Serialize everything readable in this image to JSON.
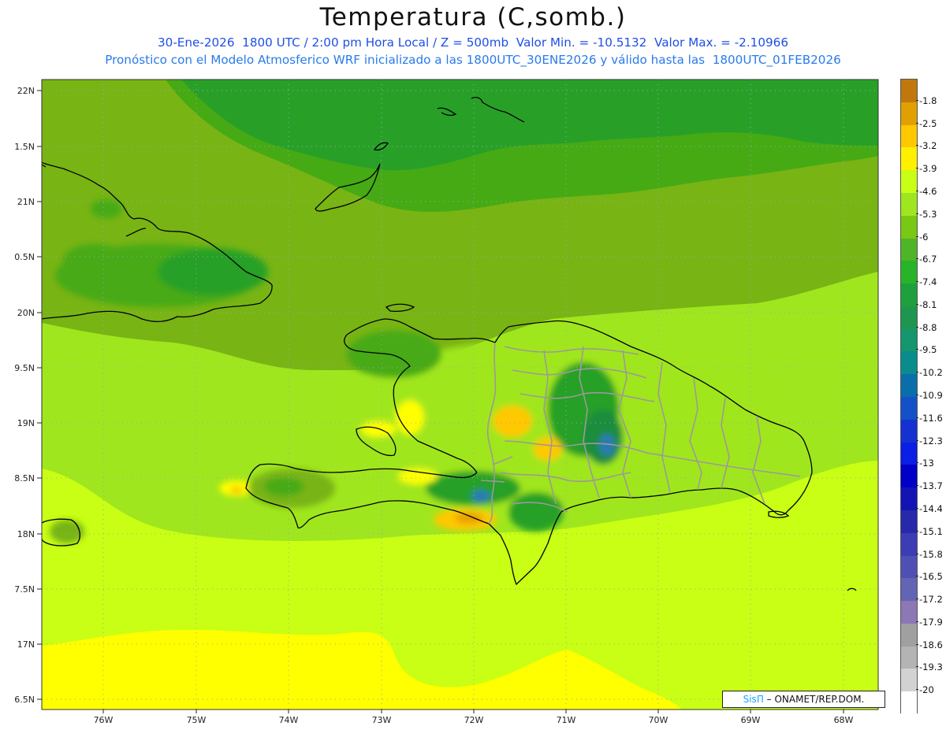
{
  "title": "Temperatura (C,somb.)",
  "subtitle_line1": "30-Ene-2026  1800 UTC / 2:00 pm Hora Local / Z = 500mb  Valor Min. = -10.5132  Valor Max. = -2.10966",
  "subtitle_line2": "Pronóstico con el Modelo Atmosferico WRF inicializado a las 1800UTC_30ENE2026 y válido hasta las  1800UTC_01FEB2026",
  "credit": {
    "brand": "SisΠ",
    "text": " – ONAMET/REP.DOM."
  },
  "latitude_labels": [
    "22N",
    "1.5N",
    "21N",
    "0.5N",
    "20N",
    "9.5N",
    "19N",
    "8.5N",
    "18N",
    "7.5N",
    "17N",
    "6.5N"
  ],
  "longitude_labels": [
    "76W",
    "75W",
    "74W",
    "73W",
    "72W",
    "71W",
    "70W",
    "69W",
    "68W"
  ],
  "colorbar": {
    "labels": [
      "-1.8",
      "-2.5",
      "-3.2",
      "-3.9",
      "-4.6",
      "-5.3",
      "-6",
      "-6.7",
      "-7.4",
      "-8.1",
      "-8.8",
      "-9.5",
      "-10.2",
      "-10.9",
      "-11.6",
      "-12.3",
      "-13",
      "-13.7",
      "-14.4",
      "-15.1",
      "-15.8",
      "-16.5",
      "-17.2",
      "-17.9",
      "-18.6",
      "-19.3",
      "-20"
    ],
    "colors": [
      "#c0780c",
      "#e0a000",
      "#ffc800",
      "#fff000",
      "#c8ff14",
      "#a0e61e",
      "#78c814",
      "#50b428",
      "#28b428",
      "#1ea03c",
      "#1e9650",
      "#14966e",
      "#0a8c8c",
      "#0a6eaa",
      "#1450c8",
      "#1432d2",
      "#0a1ee6",
      "#0000c8",
      "#1414b4",
      "#2828aa",
      "#3c3cb4",
      "#5050b4",
      "#6464b4",
      "#8c78b4",
      "#a0a0a0",
      "#b4b4b4",
      "#d2d2d2",
      "#ffffff"
    ]
  },
  "field_colors": {
    "yellow": "#ffff00",
    "yellow_green": "#c8ff14",
    "light_green": "#a0e61e",
    "olive_green": "#78b414",
    "green": "#46aa14",
    "dark_green": "#28a028",
    "teal_green": "#1e8c3c",
    "blue_core": "#2a7ab4",
    "orange": "#ffc800",
    "dark_orange": "#e8a000",
    "coast": "#000000",
    "provinces": "#9a9a9a"
  },
  "map_style": {
    "lat_lon_grid": "dotted",
    "projection": "lat-lon"
  }
}
